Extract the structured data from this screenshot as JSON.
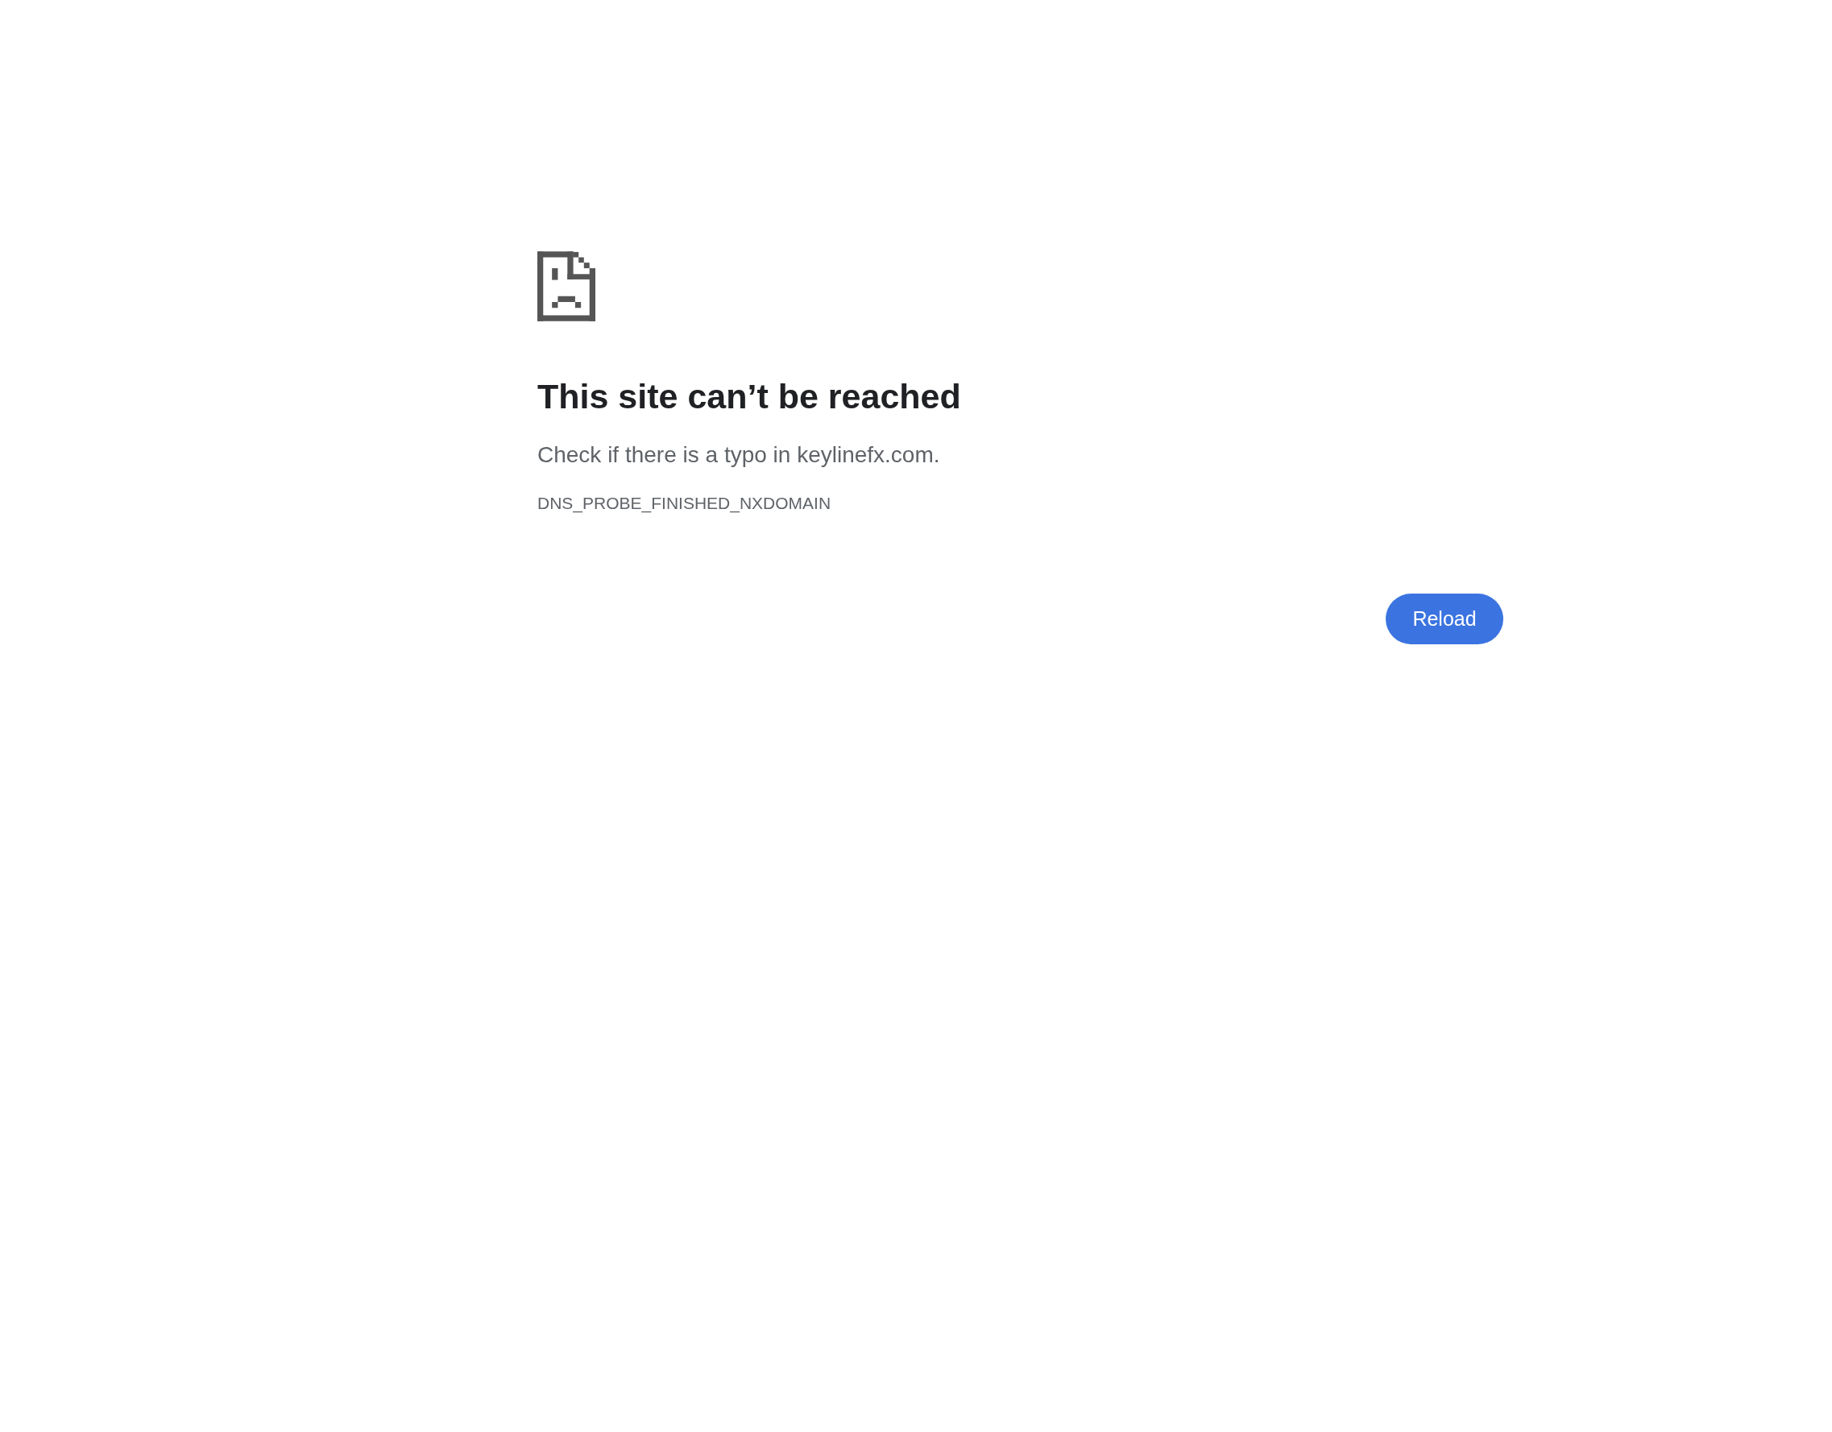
{
  "heading": "This site can’t be reached",
  "message": "Check if there is a typo in keylinefx.com.",
  "error_code": "DNS_PROBE_FINISHED_NXDOMAIN",
  "buttons": [
    {
      "label": "Reload"
    }
  ]
}
